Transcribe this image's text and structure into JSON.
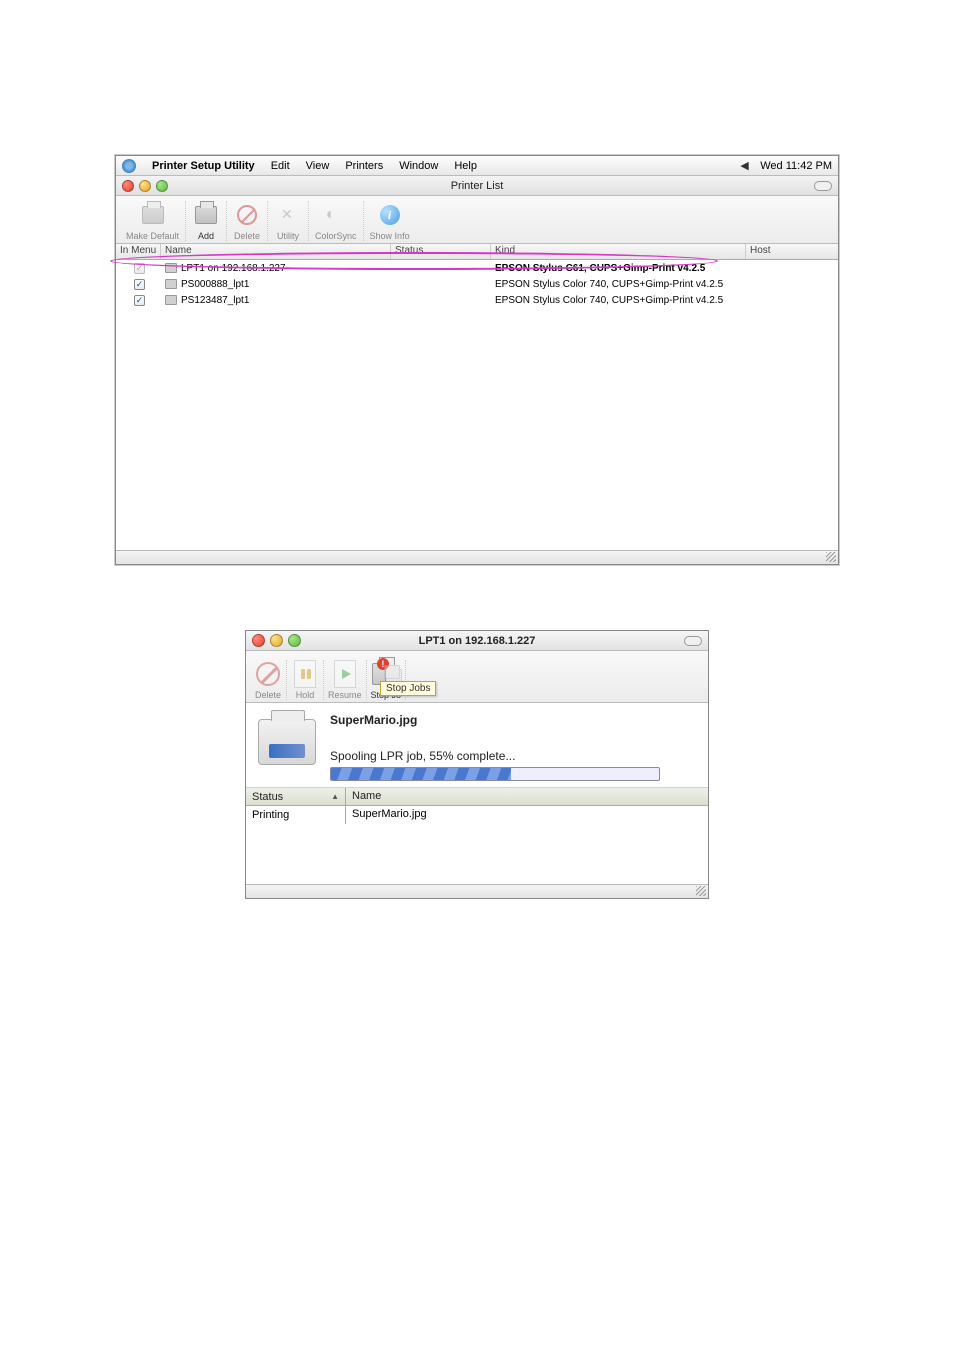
{
  "menubar": {
    "app": "Printer Setup Utility",
    "items": [
      "Edit",
      "View",
      "Printers",
      "Window",
      "Help"
    ],
    "time": "Wed 11:42 PM"
  },
  "window1": {
    "title": "Printer List",
    "toolbar": {
      "make_default": "Make Default",
      "add": "Add",
      "delete": "Delete",
      "utility": "Utility",
      "colorsync": "ColorSync",
      "show_info": "Show Info"
    },
    "columns": {
      "in_menu": "In Menu",
      "name": "Name",
      "status": "Status",
      "kind": "Kind",
      "host": "Host"
    },
    "rows": [
      {
        "name": "LPT1 on 192.168.1.227",
        "kind": "EPSON Stylus C61, CUPS+Gimp-Print v4.2.5",
        "checked": true,
        "highlighted": true,
        "check_style": "gray"
      },
      {
        "name": "PS000888_lpt1",
        "kind": "EPSON Stylus Color 740, CUPS+Gimp-Print v4.2.5",
        "checked": true,
        "check_style": "blue"
      },
      {
        "name": "PS123487_lpt1",
        "kind": "EPSON Stylus Color 740, CUPS+Gimp-Print v4.2.5",
        "checked": true,
        "check_style": "blue"
      }
    ]
  },
  "window2": {
    "title": "LPT1 on 192.168.1.227",
    "toolbar": {
      "delete": "Delete",
      "hold": "Hold",
      "resume": "Resume",
      "stop_jobs": "Stop Jo",
      "tooltip": "Stop Jobs"
    },
    "job": {
      "filename": "SuperMario.jpg",
      "status": "Spooling LPR job, 55% complete...",
      "progress_percent": 55
    },
    "queue_columns": {
      "status": "Status",
      "name": "Name"
    },
    "queue_rows": [
      {
        "status": "Printing",
        "name": "SuperMario.jpg"
      }
    ]
  }
}
